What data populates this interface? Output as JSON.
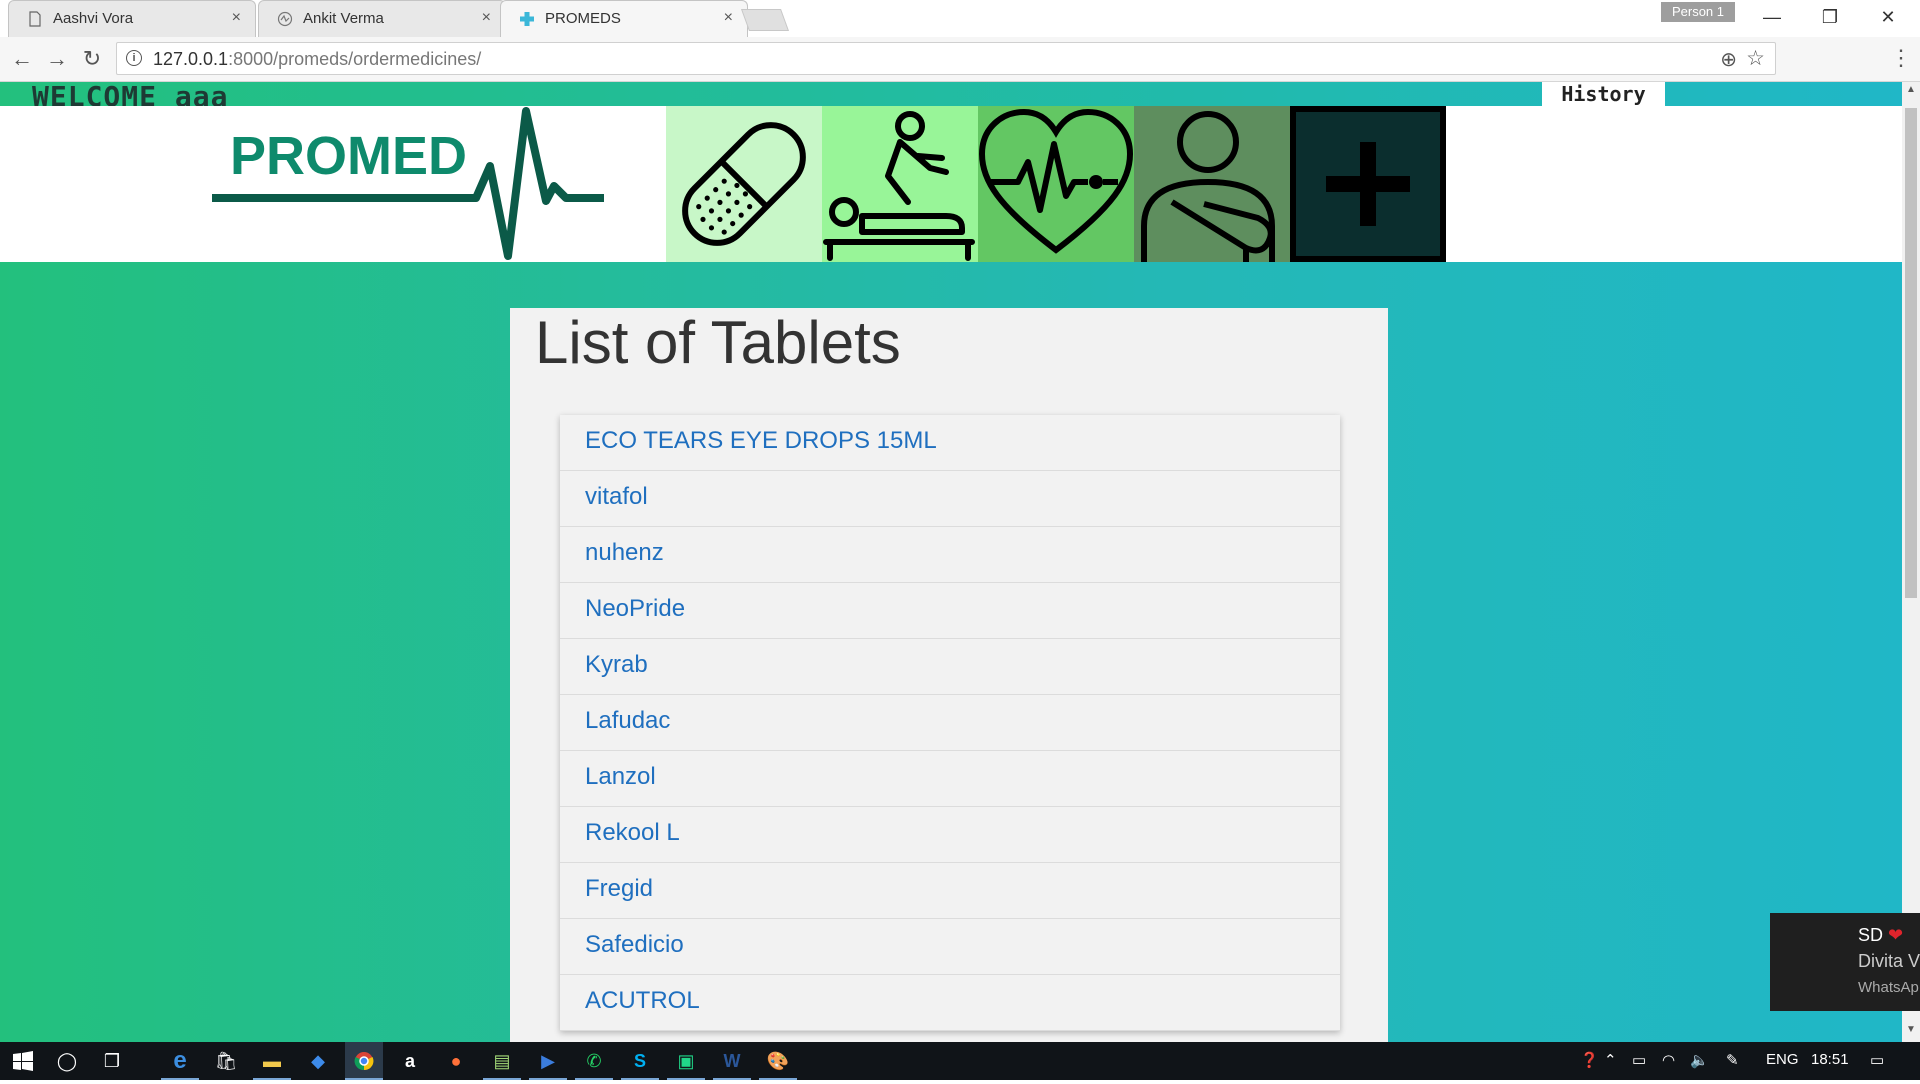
{
  "browser": {
    "tabs": [
      {
        "title": "Aashvi Vora",
        "close": "×"
      },
      {
        "title": "Ankit Verma",
        "close": "×"
      },
      {
        "title": "PROMEDS",
        "close": "×"
      }
    ],
    "profile": "Person 1",
    "window_controls": {
      "minimize": "—",
      "restore": "❐",
      "close": "✕"
    },
    "url_host": "127.0.0.1",
    "url_path": ":8000/promeds/ordermedicines/"
  },
  "page": {
    "welcome": "WELCOME aaa",
    "history_label": "History",
    "logo_text": "PROMED",
    "nav_tiles": [
      {
        "icon": "pill-icon",
        "color": "#c8f7c8"
      },
      {
        "icon": "massage-therapy-icon",
        "color": "#98f598"
      },
      {
        "icon": "heartbeat-icon",
        "color": "#63c763"
      },
      {
        "icon": "injured-person-icon",
        "color": "#5e8e5e"
      },
      {
        "icon": "plus-icon",
        "color": "#0b2e2e"
      }
    ],
    "list_title": "List of Tablets",
    "tablets": [
      "ECO TEARS EYE DROPS 15ML",
      "vitafol",
      "nuhenz",
      "NeoPride",
      "Kyrab",
      "Lafudac",
      "Lanzol",
      "Rekool L",
      "Fregid",
      "Safedicio",
      "ACUTROL"
    ]
  },
  "notification": {
    "title": "SD",
    "body": "Divita V",
    "app": "WhatsAp"
  },
  "taskbar": {
    "language": "ENG",
    "time": "18:51"
  },
  "colors": {
    "brand_green": "#0e8a6c",
    "gradient_start": "#23c07d",
    "gradient_end": "#20b7c7",
    "link": "#1f6fbf"
  }
}
